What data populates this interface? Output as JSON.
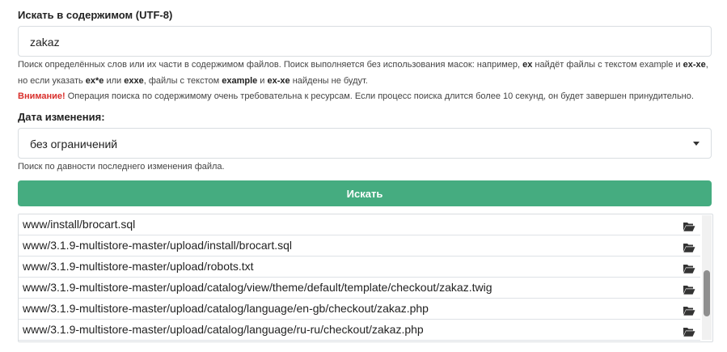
{
  "search_content": {
    "label": "Искать в содержимом (UTF-8)",
    "value": "zakaz",
    "help_line1_a": "Поиск определённых слов или их части в содержимом файлов. Поиск выполняется без использования масок: например, ",
    "help_line1_ex": "ex",
    "help_line1_b": " найдёт файлы с текстом example и ",
    "help_line1_exxe": "ex-xe",
    "help_line1_c": ",",
    "help_line2_a": "но если указать ",
    "help_line2_exstar": "ex*e",
    "help_line2_b": " или ",
    "help_line2_exxe": "exxe",
    "help_line2_c": ", файлы с текстом ",
    "help_line2_example": "example",
    "help_line2_d": " и ",
    "help_line2_exxe2": "ex-xe",
    "help_line2_e": " найдены не будут.",
    "warning_label": "Внимание!",
    "warning_text": " Операция поиска по содержимому очень требовательна к ресурсам. Если процесс поиска длится более 10 секунд, он будет завершен принудительно."
  },
  "date_filter": {
    "label": "Дата изменения:",
    "selected": "без ограничений",
    "help": "Поиск по давности последнего изменения файла."
  },
  "search_button": "Искать",
  "results": [
    "www/install/brocart.sql",
    "www/3.1.9-multistore-master/upload/install/brocart.sql",
    "www/3.1.9-multistore-master/upload/robots.txt",
    "www/3.1.9-multistore-master/upload/catalog/view/theme/default/template/checkout/zakaz.twig",
    "www/3.1.9-multistore-master/upload/catalog/language/en-gb/checkout/zakaz.php",
    "www/3.1.9-multistore-master/upload/catalog/language/ru-ru/checkout/zakaz.php"
  ],
  "icons": {
    "result_icon": "folder-open-icon",
    "select_icon": "caret-down-icon"
  },
  "colors": {
    "button": "#45ac80",
    "warning": "#d9302c"
  }
}
